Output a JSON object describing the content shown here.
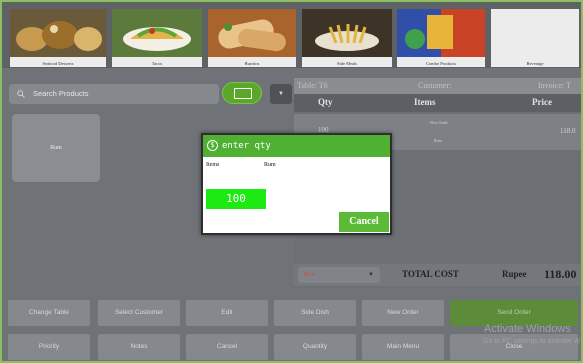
{
  "categories": [
    {
      "label": "Seafood Desserts",
      "icon": "seafood-dessert-photo"
    },
    {
      "label": "Tacos",
      "icon": "tacos-photo"
    },
    {
      "label": "Burritos",
      "icon": "burritos-photo"
    },
    {
      "label": "Side Meals",
      "icon": "side-meals-photo"
    },
    {
      "label": "Combo Products",
      "icon": "combo-products-photo"
    },
    {
      "label": "Beverage",
      "icon": "beverage-placeholder"
    }
  ],
  "search": {
    "placeholder": "Search Products"
  },
  "products": [
    {
      "label": "Rum"
    }
  ],
  "order": {
    "table": "Table: T6",
    "customer": "Customer:",
    "invoice": "Invoice: T",
    "columns": {
      "qty": "Qty",
      "items": "Items",
      "price": "Price"
    },
    "row": {
      "qty": "100",
      "item_line1": "New Order",
      "item_line2": "Rum",
      "price": "118.0"
    },
    "status_select": "Rum",
    "total_label": "TOTAL COST",
    "currency": "Rupee",
    "total_value": "118.00"
  },
  "actions_row1": [
    "Change Table",
    "Select Customer",
    "Edit",
    "Side Dish",
    "New Order",
    "Send Order"
  ],
  "actions_row2": [
    "Priority",
    "Notes",
    "Cancel",
    "Quantity",
    "Main Menu",
    "Close"
  ],
  "watermark": {
    "title": "Activate Windows",
    "subtitle": "Go to PC settings to activate W"
  },
  "modal": {
    "title": "enter qty",
    "label_items": "Items",
    "item_name": "Rum",
    "qty_value": "100",
    "cancel_label": "Cancel"
  },
  "colors": {
    "accent_green": "#4fb031",
    "qty_green": "#1cea12",
    "frame_green": "#8cbf5f"
  }
}
